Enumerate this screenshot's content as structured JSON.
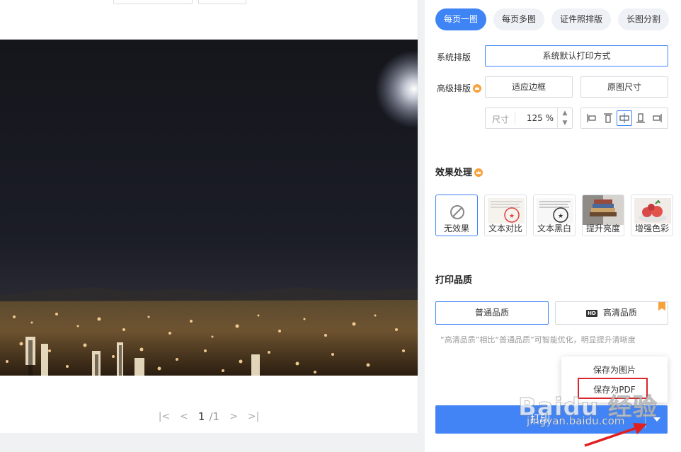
{
  "tabs": [
    {
      "label": "每页一图",
      "active": true
    },
    {
      "label": "每页多图",
      "active": false
    },
    {
      "label": "证件照排版",
      "active": false
    },
    {
      "label": "长图分割",
      "active": false
    }
  ],
  "layout": {
    "system_label": "系统排版",
    "system_option": "系统默认打印方式",
    "advanced_label": "高级排版",
    "fit_border": "适应边框",
    "original_size": "原图尺寸",
    "size_label": "尺寸",
    "size_value": "125 %"
  },
  "effects": {
    "title": "效果处理",
    "items": [
      {
        "label": "无效果",
        "selected": true
      },
      {
        "label": "文本对比",
        "selected": false
      },
      {
        "label": "文本黑白",
        "selected": false
      },
      {
        "label": "提升亮度",
        "selected": false
      },
      {
        "label": "增强色彩",
        "selected": false
      }
    ]
  },
  "quality": {
    "title": "打印品质",
    "normal": "普通品质",
    "hd_badge": "HD",
    "hd": "高清品质",
    "note": "“高清品质”相比“普通品质”可智能优化，明显提升清晰度"
  },
  "popup": {
    "save_image": "保存为图片",
    "save_pdf": "保存为PDF"
  },
  "print_button": "打印",
  "pager": {
    "current": "1",
    "total": "/1"
  },
  "watermark": {
    "main": "Baidu 经验",
    "sub": "jingyan.baidu.com"
  },
  "colors": {
    "accent": "#3f84f5",
    "highlight": "#d9262c",
    "crown": "#f7a23b"
  }
}
